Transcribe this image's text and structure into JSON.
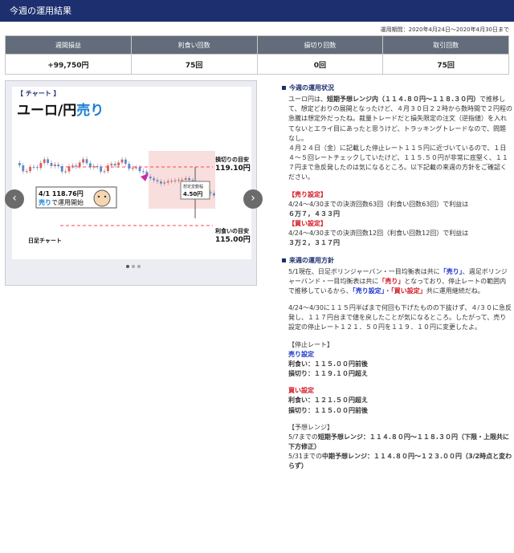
{
  "header": {
    "title": "今週の運用結果"
  },
  "period": "運用期間：2020年4月24日～2020年4月30日まで",
  "stats": {
    "headers": [
      "週間損益",
      "利食い回数",
      "損切り回数",
      "取引回数"
    ],
    "values": [
      "+99,750円",
      "75回",
      "0回",
      "75回"
    ]
  },
  "slide": {
    "tag": "【 チャート 】",
    "pair": "ユーロ/円",
    "side": "売り",
    "stop_label": "損切りの目安",
    "stop_value": "119.10円",
    "entry_date": "4/1",
    "entry_price": "118.76円",
    "entry_side": "売り",
    "entry_text": "で運用開始",
    "range_label": "想定変動幅",
    "range_value": "4.50円",
    "take_label": "利食いの目安",
    "take_value": "115.00円",
    "chart_name": "日足チャート"
  },
  "status": {
    "title": "今週の運用状況",
    "paragraph_html": "ユーロ円は、<b>短期予想レンジ内（１１４.８０円～１１８.３０円）</b>で推移して、想定どおりの展開となったけど、４月３０日２２時から数時間で２円程の急騰は想定外だったね。裁量トレードだと損失限定の注文（逆指値）を入れてないとエライ目にあったと思うけど、トラッキングトレードなので、問題なし。<br>４月２４日（金）に記載した停止レート１１５円に近づいているので、１日４～５回レートチェックしていたけど、１１５.５０円が非常に底堅く、１１７円まで急反発したのは気になるところ。以下記載の来週の方針をご確認ください。",
    "sell_label": "【売り設定】",
    "sell_line": "4/24～4/30までの決済回数63回（利食い回数63回）で利益は",
    "sell_profit": "６万７，４３３円",
    "buy_label": "【買い設定】",
    "buy_line": "4/24～4/30までの決済回数12回（利食い回数12回）で利益は",
    "buy_profit": "３万２，３１７円"
  },
  "policy": {
    "title": "来週の運用方針",
    "p1_html": "5/1現在、日足ボリンジャーバン・一目均衡表は共に<span class=\"blue\">「売り」</span>、週足ボリンジャーバンド・一目均衡表は共に<span class=\"red\">「売り」</span>となっており、停止レートの範囲内で推移しているから、<span class=\"blue\">「売り設定」</span>・<span class=\"red\">「買い設定」</span>共に運用継続だね。",
    "p2": "4/24～4/30に１１５円半ばまで何回も下げたものの下抜けず、４/３０に急反発し、１１７円台まで値を戻したことが気になるところ。したがって、売り設定の停止レート１２１．５０円を１１９．１０円に変更したよ。",
    "stop_heading": "【停止レート】",
    "sell_label": "売り設定",
    "sell_take": "利食い：１１５.００円前後",
    "sell_stop": "損切り：１１９.１０円超え",
    "buy_label": "買い設定",
    "buy_take": "利食い：１２１.５０円超え",
    "buy_stop": "損切り：１１５.００円前後",
    "range_heading": "【予想レンジ】",
    "short_range_html": "5/7までの<b>短期予想レンジ：１１４.８０円～１１８.３０円（下限・上限共に下方修正）</b>",
    "mid_range_html": "5/31までの<b>中期予想レンジ：１１４.８０円～１２３.００円（3/2時点と変わらず）</b>"
  },
  "colors": {
    "navy": "#1d2f6e",
    "header_gray": "#636c7a",
    "sell_blue": "#1a33c8",
    "buy_red": "#d0101c"
  }
}
